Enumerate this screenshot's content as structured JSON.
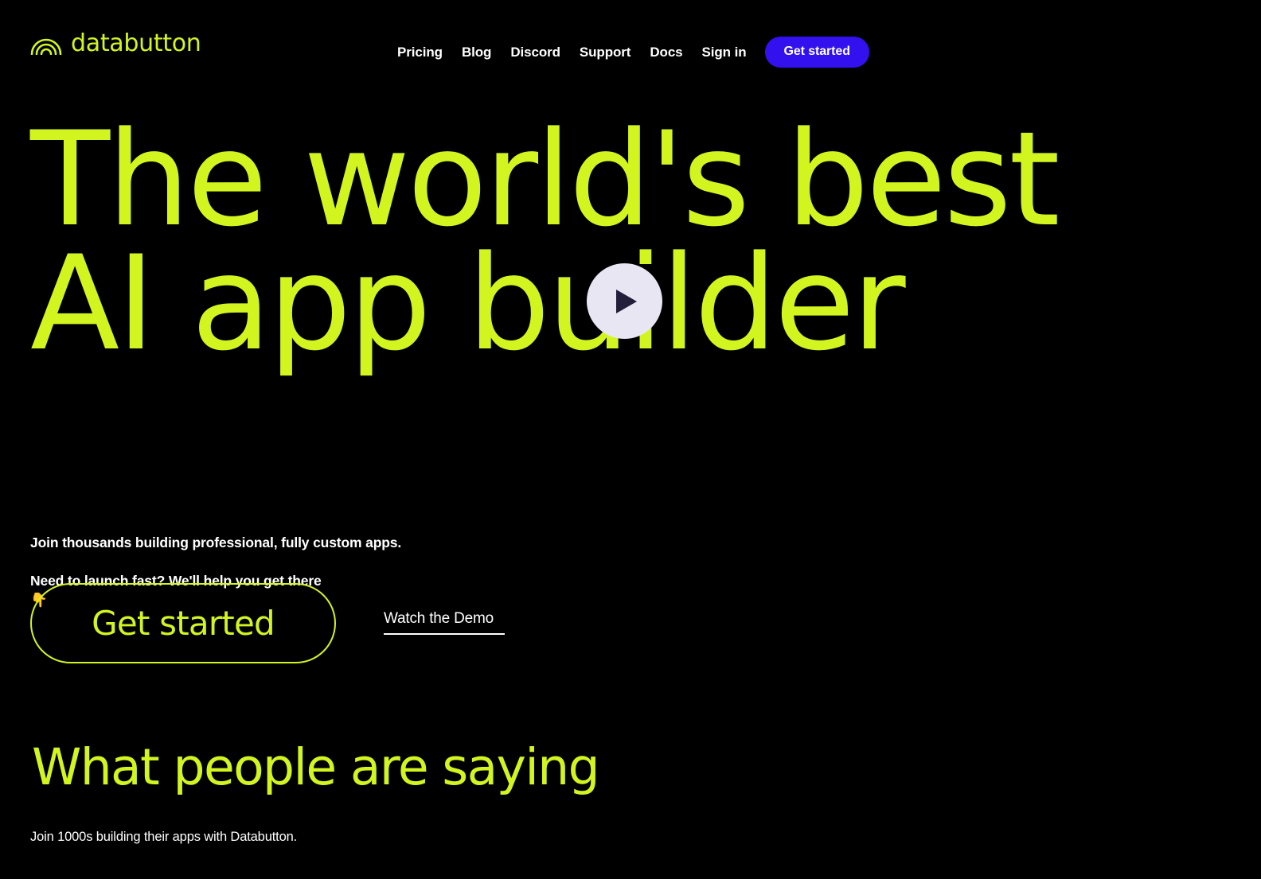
{
  "brand": {
    "name": "databutton",
    "logo_icon": "rainbow-arc-icon",
    "accent_color": "#d2f520",
    "cta_color": "#3311ee",
    "background_color": "#000000"
  },
  "header": {
    "nav": [
      {
        "label": "Pricing"
      },
      {
        "label": "Blog"
      },
      {
        "label": "Discord"
      },
      {
        "label": "Support"
      },
      {
        "label": "Docs"
      },
      {
        "label": "Sign in"
      }
    ],
    "cta_label": "Get started"
  },
  "hero": {
    "headline": "The world's best\nAI app builder",
    "headline_line_1": "The world's best",
    "headline_line_2": "AI app builder",
    "play_icon": "play-icon",
    "subtitle": "Join thousands building professional, fully custom apps.\nNeed to launch fast? We'll help you get there ",
    "subtitle_line_1": "Join thousands building professional, fully custom apps.",
    "subtitle_line_2": "Need to launch fast? We'll help you get there",
    "subtitle_emoji": "👇",
    "primary_cta_label": "Get started",
    "secondary_cta_label": "Watch the Demo"
  },
  "testimonials": {
    "heading": "What people are saying",
    "subheading": "Join 1000s building their apps with Databutton."
  }
}
